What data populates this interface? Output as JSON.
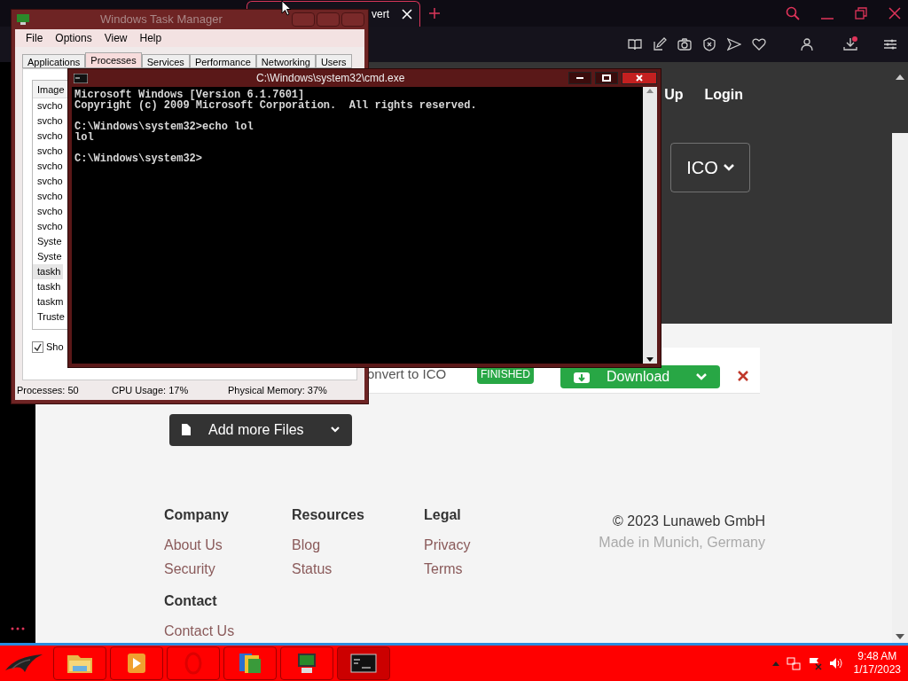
{
  "browser": {
    "tab": {
      "title": "vert"
    }
  },
  "page": {
    "nav": [
      {
        "label": "Up"
      },
      {
        "label": "Login"
      }
    ],
    "format_button": "ICO",
    "file_row": {
      "name": "onvert to ICO",
      "status": "FINISHED",
      "download": "Download"
    },
    "add_files": "Add more Files",
    "footer": {
      "columns": [
        {
          "heading": "Company",
          "links": [
            "About Us",
            "Security"
          ]
        },
        {
          "heading": "Resources",
          "links": [
            "Blog",
            "Status"
          ]
        },
        {
          "heading": "Legal",
          "links": [
            "Privacy",
            "Terms"
          ]
        }
      ],
      "contact": {
        "heading": "Contact",
        "links": [
          "Contact Us"
        ]
      },
      "copyright": "© 2023 Lunaweb GmbH",
      "location": "Made in Munich, Germany"
    }
  },
  "task_manager": {
    "title": "Windows Task Manager",
    "menu": [
      "File",
      "Options",
      "View",
      "Help"
    ],
    "tabs": [
      {
        "label": "Applications",
        "selected": false
      },
      {
        "label": "Processes",
        "selected": true
      },
      {
        "label": "Services",
        "selected": false
      },
      {
        "label": "Performance",
        "selected": false
      },
      {
        "label": "Networking",
        "selected": false
      },
      {
        "label": "Users",
        "selected": false
      }
    ],
    "column": "Image",
    "rows": [
      {
        "name": "svcho",
        "selected": false
      },
      {
        "name": "svcho",
        "selected": false
      },
      {
        "name": "svcho",
        "selected": false
      },
      {
        "name": "svcho",
        "selected": false
      },
      {
        "name": "svcho",
        "selected": false
      },
      {
        "name": "svcho",
        "selected": false
      },
      {
        "name": "svcho",
        "selected": false
      },
      {
        "name": "svcho",
        "selected": false
      },
      {
        "name": "svcho",
        "selected": false
      },
      {
        "name": "Syste",
        "selected": false
      },
      {
        "name": "Syste",
        "selected": false
      },
      {
        "name": "taskh",
        "selected": true
      },
      {
        "name": "taskh",
        "selected": false
      },
      {
        "name": "taskm",
        "selected": false
      },
      {
        "name": "Truste",
        "selected": false
      }
    ],
    "show_all": {
      "label": "Sho",
      "checked": true
    },
    "status": [
      "Processes: 50",
      "CPU Usage: 17%",
      "Physical Memory: 37%"
    ]
  },
  "cmd": {
    "title": "C:\\Windows\\system32\\cmd.exe",
    "blocks": [
      [
        "Microsoft Windows [Version 6.1.7601]",
        "Copyright (c) 2009 Microsoft Corporation.  All rights reserved."
      ],
      [
        "C:\\Windows\\system32>echo lol",
        "lol"
      ],
      [
        "C:\\Windows\\system32>"
      ]
    ]
  },
  "taskbar": {
    "time": "9:48 AM",
    "date": "1/17/2023"
  }
}
